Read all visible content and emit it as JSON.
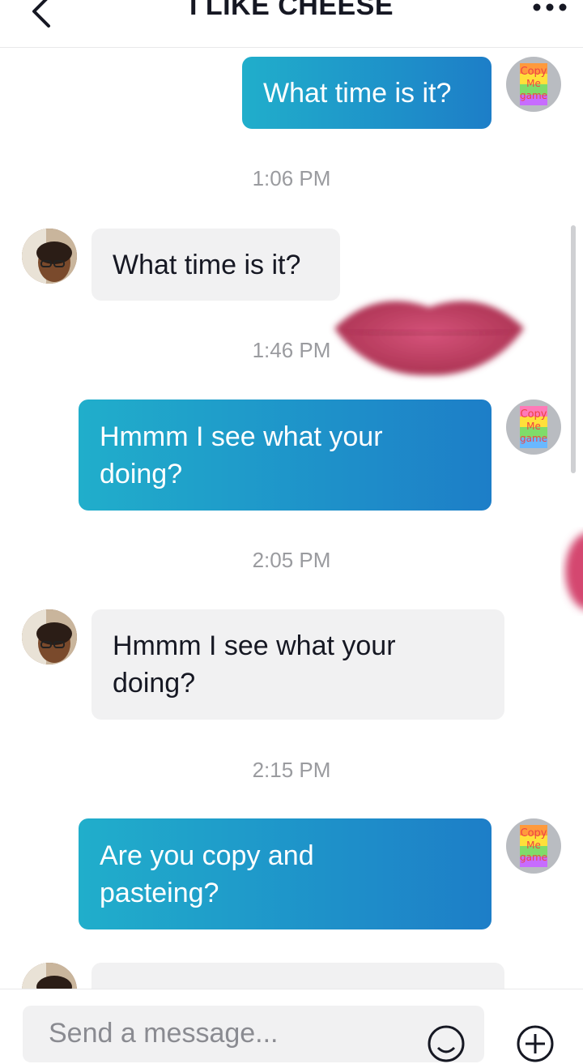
{
  "header": {
    "title": "I LIKE CHEESE",
    "back_icon": "chevron-left-icon",
    "more_icon": "more-horizontal-icon"
  },
  "messages": [
    {
      "type": "sent",
      "text": "What time is it?"
    },
    {
      "type": "timestamp",
      "text": "1:06 PM"
    },
    {
      "type": "received",
      "text": "What time is it?"
    },
    {
      "type": "timestamp",
      "text": "1:46 PM"
    },
    {
      "type": "sent",
      "text": "Hmmm I see what your doing?"
    },
    {
      "type": "timestamp",
      "text": "2:05 PM"
    },
    {
      "type": "received",
      "text": "Hmmm I see what your doing?"
    },
    {
      "type": "timestamp",
      "text": "2:15 PM"
    },
    {
      "type": "sent",
      "text": "Are you copy and pasteing?"
    }
  ],
  "avatar_text": {
    "line1": "Copy",
    "line2": "Me",
    "line3": "game"
  },
  "composer": {
    "placeholder": "Send a message...",
    "emoji_icon": "emoji-icon",
    "add_icon": "plus-circle-icon"
  },
  "colors": {
    "sent_gradient_start": "#20aecb",
    "sent_gradient_end": "#1d7ec8",
    "received_bubble": "#f1f1f2",
    "timestamp": "#9a9b9f"
  }
}
